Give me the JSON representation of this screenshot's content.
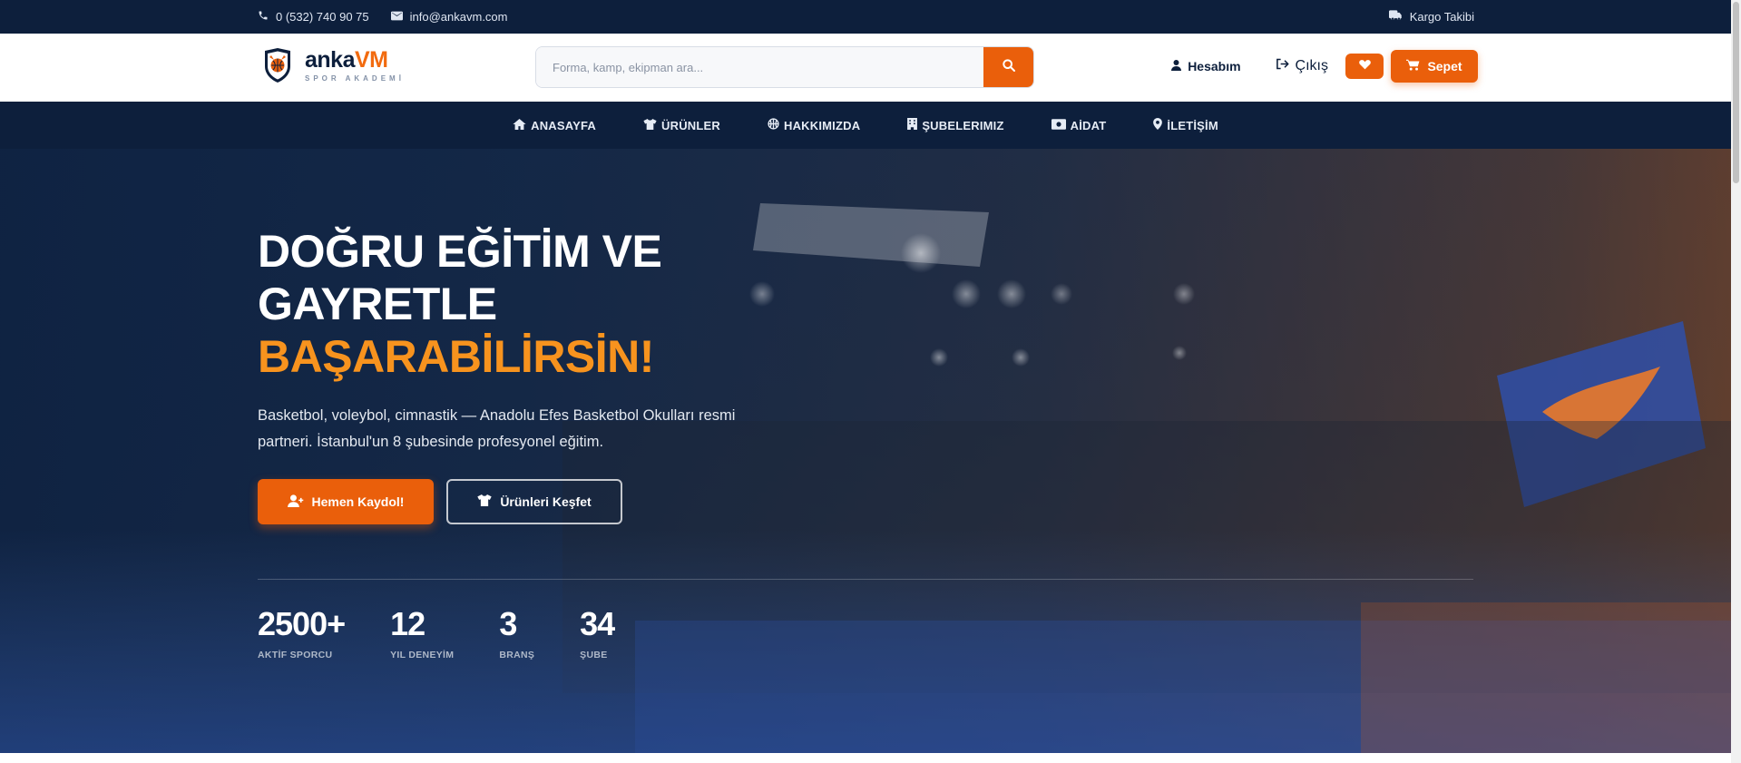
{
  "topbar": {
    "phone": "0 (532) 740 90 75",
    "email": "info@ankavm.com",
    "tracking": "Kargo Takibi"
  },
  "header": {
    "logo_main_a": "anka",
    "logo_main_b": "VM",
    "logo_sub": "SPOR AKADEMİ",
    "search_placeholder": "Forma, kamp, ekipman ara...",
    "account": "Hesabım",
    "logout": "Çıkış",
    "cart": "Sepet"
  },
  "nav": {
    "items": [
      {
        "label": "ANASAYFA",
        "icon": "home-icon"
      },
      {
        "label": "ÜRÜNLER",
        "icon": "shirt-icon"
      },
      {
        "label": "HAKKIMIZDA",
        "icon": "basketball-icon"
      },
      {
        "label": "ŞUBELERIMIZ",
        "icon": "building-icon"
      },
      {
        "label": "AİDAT",
        "icon": "money-icon"
      },
      {
        "label": "İLETİŞİM",
        "icon": "map-pin-icon"
      }
    ]
  },
  "hero": {
    "title_line1": "DOĞRU EĞİTİM VE",
    "title_line2": "GAYRETLE",
    "title_accent": "BAŞARABİLİRSİN!",
    "description": "Basketbol, voleybol, cimnastik — Anadolu Efes Basketbol Okulları resmi partneri. İstanbul'un 8 şubesinde profesyonel eğitim.",
    "btn_primary": "Hemen Kaydol!",
    "btn_secondary": "Ürünleri Keşfet"
  },
  "stats": [
    {
      "value": "2500+",
      "label": "AKTİF SPORCU"
    },
    {
      "value": "12",
      "label": "YIL DENEYİM"
    },
    {
      "value": "3",
      "label": "BRANŞ"
    },
    {
      "value": "34",
      "label": "ŞUBE"
    }
  ],
  "colors": {
    "navy": "#0d1f3c",
    "orange": "#ea5f0b",
    "accent_text": "#f7931e"
  }
}
